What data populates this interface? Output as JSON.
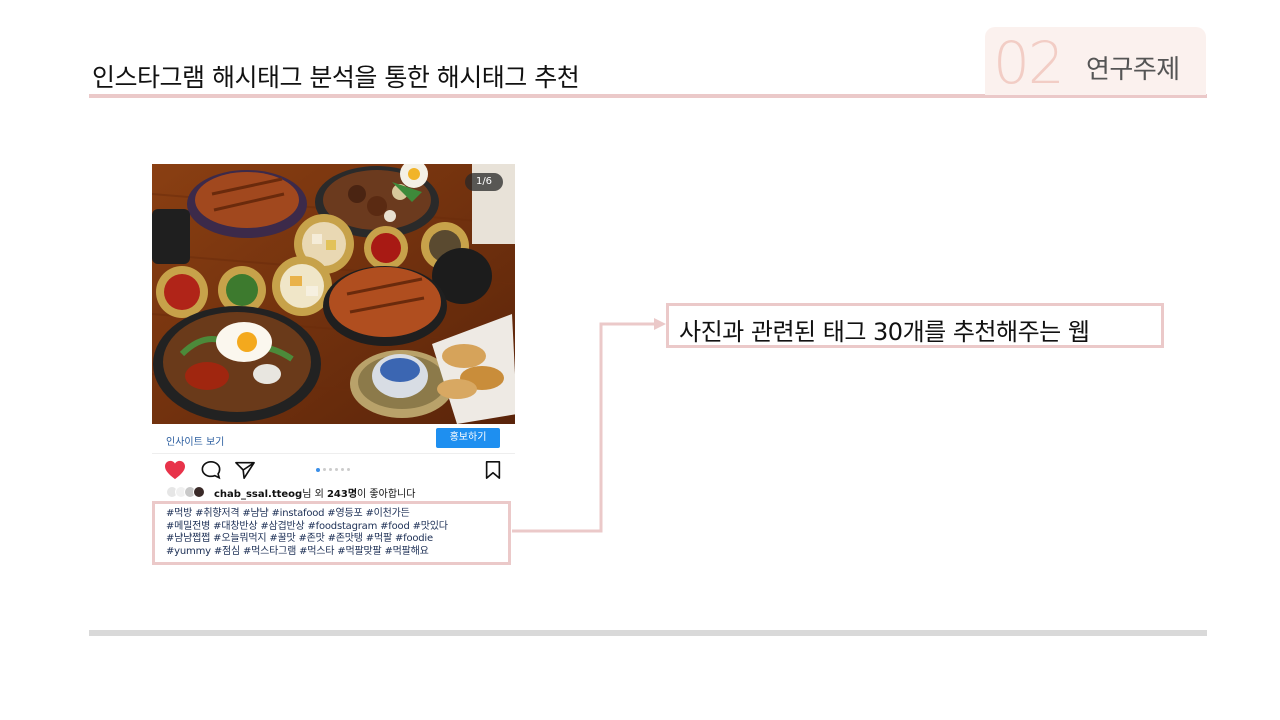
{
  "slide": {
    "title": "인스타그램 해시태그 분석을 통한 해시태그 추천",
    "section_number": "02",
    "section_label": "연구주제",
    "callout_text": "사진과 관련된 태그 30개를 추천해주는 웹"
  },
  "post": {
    "image_counter": "1/6",
    "insights_label": "인사이트 보기",
    "promote_label": "홍보하기",
    "carousel_pages": 6,
    "carousel_active_index": 0,
    "likes_username": "chab_ssal.tteog",
    "likes_mid": "님 외 ",
    "likes_count": "243명",
    "likes_suffix": "이 좋아합니다",
    "hashtag_lines": [
      "#먹방 #취향저격 #냠냠 #instafood #영등포 #이천가든",
      "#메밀전병 #대창반상 #삼겹반상 #foodstagram #food #맛있다",
      "#냠냠쩝쩝 #오늘뭐먹지 #꿀맛 #존맛 #존맛탱 #먹팔 #foodie",
      "#yummy #점심 #먹스타그램 #먹스타 #먹팔맞팔 #먹팔해요"
    ]
  },
  "colors": {
    "accent_pink": "#ebc9c9",
    "section_number": "#f2cdc5",
    "like_heart": "#e8334a",
    "promote_blue": "#1e8ff0",
    "bottom_rule": "#d9d9d9"
  },
  "icons": [
    "heart-icon",
    "comment-icon",
    "share-icon",
    "bookmark-icon"
  ]
}
